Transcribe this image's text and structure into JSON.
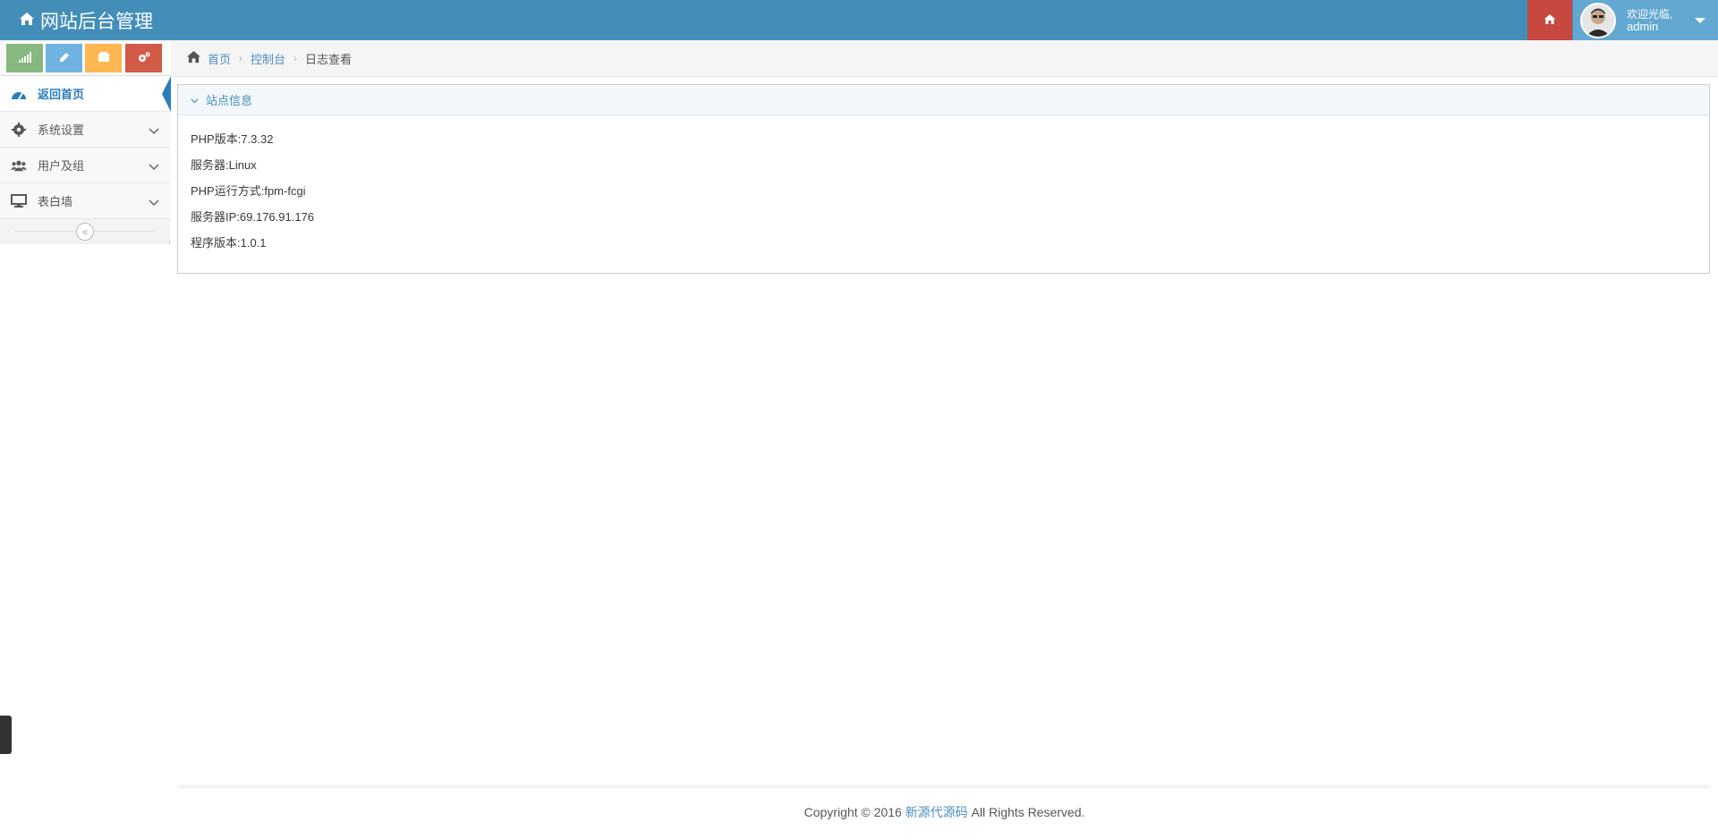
{
  "navbar": {
    "brand": "网站后台管理",
    "welcome": "欢迎光临,",
    "username": "admin"
  },
  "shortcuts": [
    {
      "name": "stats",
      "color": "#87b87f",
      "icon": "signal-icon"
    },
    {
      "name": "edit",
      "color": "#6fb3e0",
      "icon": "pencil-icon"
    },
    {
      "name": "users",
      "color": "#ffb752",
      "icon": "group-icon"
    },
    {
      "name": "settings",
      "color": "#d15b47",
      "icon": "cogs-icon"
    }
  ],
  "sidebar": {
    "items": [
      {
        "label": "返回首页",
        "icon": "dashboard-icon",
        "active": true
      },
      {
        "label": "系统设置",
        "icon": "gear-icon"
      },
      {
        "label": "用户及组",
        "icon": "users-icon"
      },
      {
        "label": "表白墙",
        "icon": "desktop-icon"
      }
    ]
  },
  "breadcrumb": {
    "home": "首页",
    "section": "控制台",
    "current": "日志查看"
  },
  "widget": {
    "title": "站点信息",
    "rows": [
      "PHP版本:7.3.32",
      "服务器:Linux",
      "PHP运行方式:fpm-fcgi",
      "服务器IP:69.176.91.176",
      "程序版本:1.0.1"
    ]
  },
  "footer": {
    "prefix": "Copyright © 2016 ",
    "brand": "新源代源码",
    "suffix": " All Rights Reserved."
  },
  "colors": {
    "navbar": "#438eb9",
    "accent": "#2b7dbc",
    "home_button": "#c6483e",
    "user_box": "#62a8d1"
  }
}
